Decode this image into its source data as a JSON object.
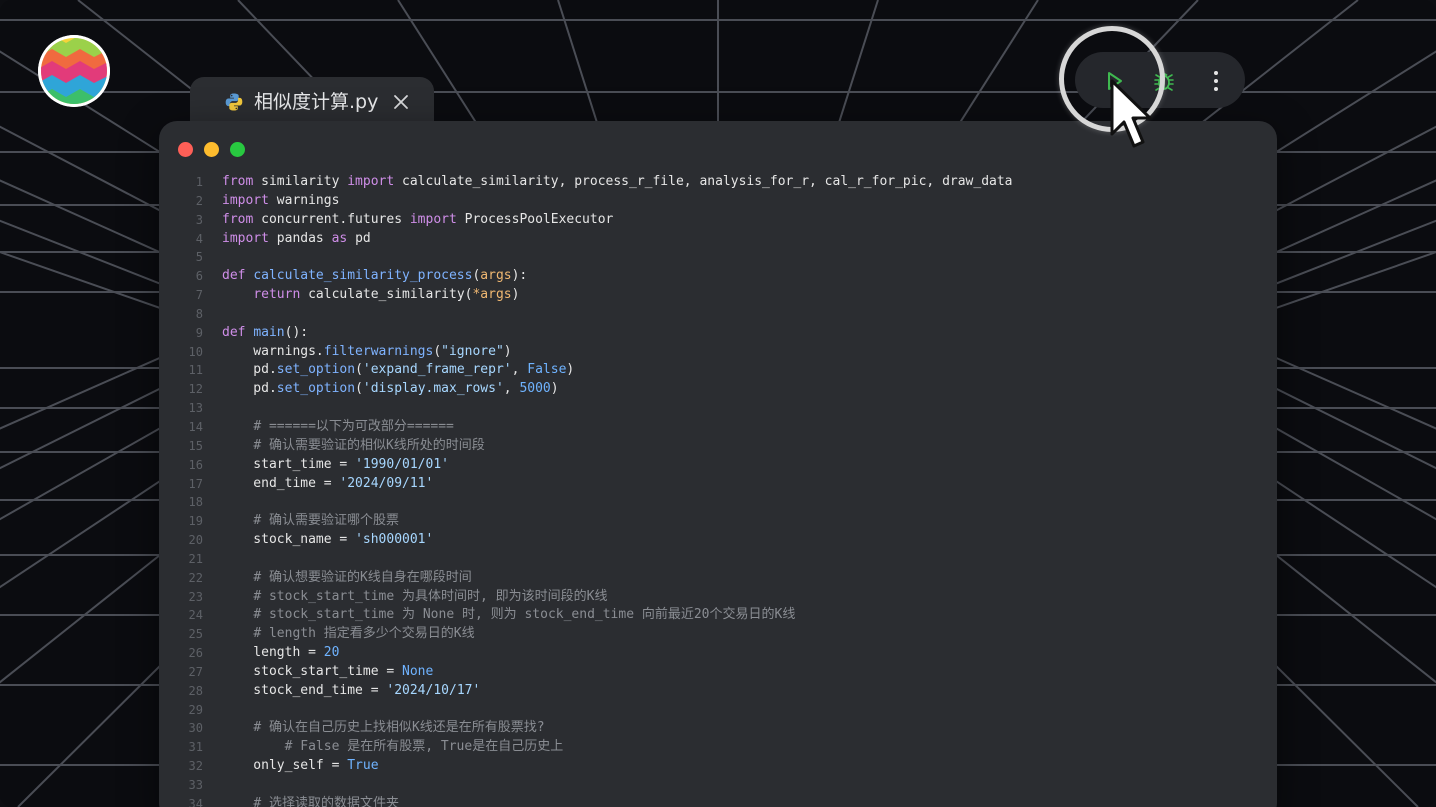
{
  "tab": {
    "filename": "相似度计算.py",
    "file_icon": "python-icon",
    "close_icon": "close-icon"
  },
  "toolbar": {
    "run_icon": "play-icon",
    "debug_icon": "bug-icon",
    "more_icon": "more-vertical-icon",
    "accent": "#3fb950"
  },
  "window_controls": {
    "close_color": "#fe5f57",
    "minimize_color": "#febc2e",
    "maximize_color": "#28c840"
  },
  "code_lines": [
    [
      [
        "kw",
        "from"
      ],
      [
        "t",
        " similarity "
      ],
      [
        "kw",
        "import"
      ],
      [
        "t",
        " calculate_similarity, process_r_file, analysis_for_r, cal_r_for_pic, draw_data"
      ]
    ],
    [
      [
        "kw",
        "import"
      ],
      [
        "t",
        " warnings"
      ]
    ],
    [
      [
        "kw",
        "from"
      ],
      [
        "t",
        " concurrent.futures "
      ],
      [
        "kw",
        "import"
      ],
      [
        "t",
        " ProcessPoolExecutor"
      ]
    ],
    [
      [
        "kw",
        "import"
      ],
      [
        "t",
        " pandas "
      ],
      [
        "kw",
        "as"
      ],
      [
        "t",
        " pd"
      ]
    ],
    [],
    [
      [
        "kw",
        "def"
      ],
      [
        "t",
        " "
      ],
      [
        "fn",
        "calculate_similarity_process"
      ],
      [
        "t",
        "("
      ],
      [
        "pm",
        "args"
      ],
      [
        "t",
        "):"
      ]
    ],
    [
      [
        "t",
        "    "
      ],
      [
        "kw",
        "return"
      ],
      [
        "t",
        " calculate_similarity("
      ],
      [
        "pm",
        "*args"
      ],
      [
        "t",
        ")"
      ]
    ],
    [],
    [
      [
        "kw",
        "def"
      ],
      [
        "t",
        " "
      ],
      [
        "fn",
        "main"
      ],
      [
        "t",
        "():"
      ]
    ],
    [
      [
        "t",
        "    warnings."
      ],
      [
        "fn",
        "filterwarnings"
      ],
      [
        "t",
        "("
      ],
      [
        "str",
        "\"ignore\""
      ],
      [
        "t",
        ")"
      ]
    ],
    [
      [
        "t",
        "    pd."
      ],
      [
        "fn",
        "set_option"
      ],
      [
        "t",
        "("
      ],
      [
        "str",
        "'expand_frame_repr'"
      ],
      [
        "t",
        ", "
      ],
      [
        "const",
        "False"
      ],
      [
        "t",
        ")"
      ]
    ],
    [
      [
        "t",
        "    pd."
      ],
      [
        "fn",
        "set_option"
      ],
      [
        "t",
        "("
      ],
      [
        "str",
        "'display.max_rows'"
      ],
      [
        "t",
        ", "
      ],
      [
        "num",
        "5000"
      ],
      [
        "t",
        ")"
      ]
    ],
    [],
    [
      [
        "t",
        "    "
      ],
      [
        "cm",
        "# ======以下为可改部分======"
      ]
    ],
    [
      [
        "t",
        "    "
      ],
      [
        "cm",
        "# 确认需要验证的相似K线所处的时间段"
      ]
    ],
    [
      [
        "t",
        "    start_time = "
      ],
      [
        "str",
        "'1990/01/01'"
      ]
    ],
    [
      [
        "t",
        "    end_time = "
      ],
      [
        "str",
        "'2024/09/11'"
      ]
    ],
    [],
    [
      [
        "t",
        "    "
      ],
      [
        "cm",
        "# 确认需要验证哪个股票"
      ]
    ],
    [
      [
        "t",
        "    stock_name = "
      ],
      [
        "str",
        "'sh000001'"
      ]
    ],
    [],
    [
      [
        "t",
        "    "
      ],
      [
        "cm",
        "# 确认想要验证的K线自身在哪段时间"
      ]
    ],
    [
      [
        "t",
        "    "
      ],
      [
        "cm",
        "# stock_start_time 为具体时间时, 即为该时间段的K线"
      ]
    ],
    [
      [
        "t",
        "    "
      ],
      [
        "cm",
        "# stock_start_time 为 None 时, 则为 stock_end_time 向前最近20个交易日的K线"
      ]
    ],
    [
      [
        "t",
        "    "
      ],
      [
        "cm",
        "# length 指定看多少个交易日的K线"
      ]
    ],
    [
      [
        "t",
        "    length = "
      ],
      [
        "num",
        "20"
      ]
    ],
    [
      [
        "t",
        "    stock_start_time = "
      ],
      [
        "const",
        "None"
      ]
    ],
    [
      [
        "t",
        "    stock_end_time = "
      ],
      [
        "str",
        "'2024/10/17'"
      ]
    ],
    [],
    [
      [
        "t",
        "    "
      ],
      [
        "cm",
        "# 确认在自己历史上找相似K线还是在所有股票找?"
      ]
    ],
    [
      [
        "t",
        "        "
      ],
      [
        "cm",
        "# False 是在所有股票, True是在自己历史上"
      ]
    ],
    [
      [
        "t",
        "    only_self = "
      ],
      [
        "const",
        "True"
      ]
    ],
    [],
    [
      [
        "t",
        "    "
      ],
      [
        "cm",
        "# 选择读取的数据文件夹"
      ]
    ]
  ]
}
